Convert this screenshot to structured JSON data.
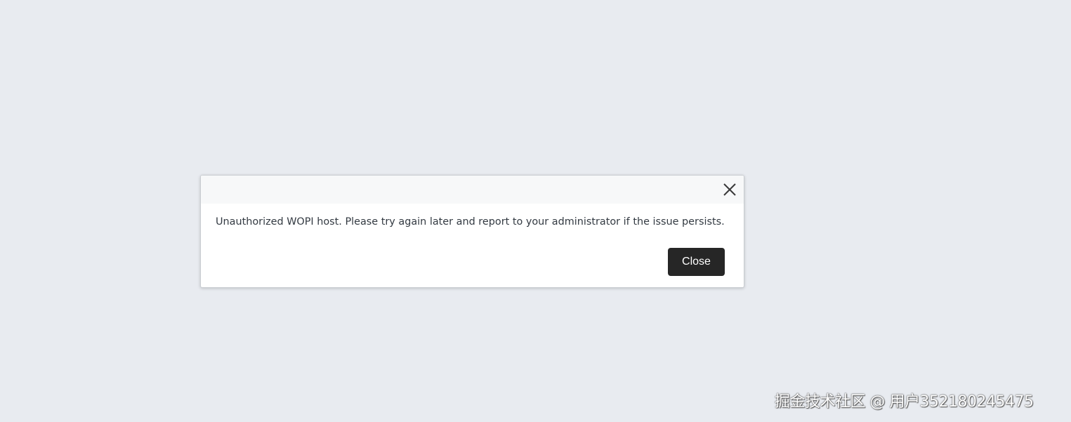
{
  "dialog": {
    "message": "Unauthorized WOPI host. Please try again later and report to your administrator if the issue persists.",
    "close_button_label": "Close",
    "close_icon": "close-icon"
  },
  "watermark": {
    "text": "掘金技术社区 @ 用户352180245475"
  },
  "colors": {
    "page_background": "#e8ebf0",
    "dialog_background": "#ffffff",
    "header_background": "#f7f8f9",
    "button_background": "#262626",
    "button_text": "#ffffff",
    "message_text": "#333a42"
  }
}
